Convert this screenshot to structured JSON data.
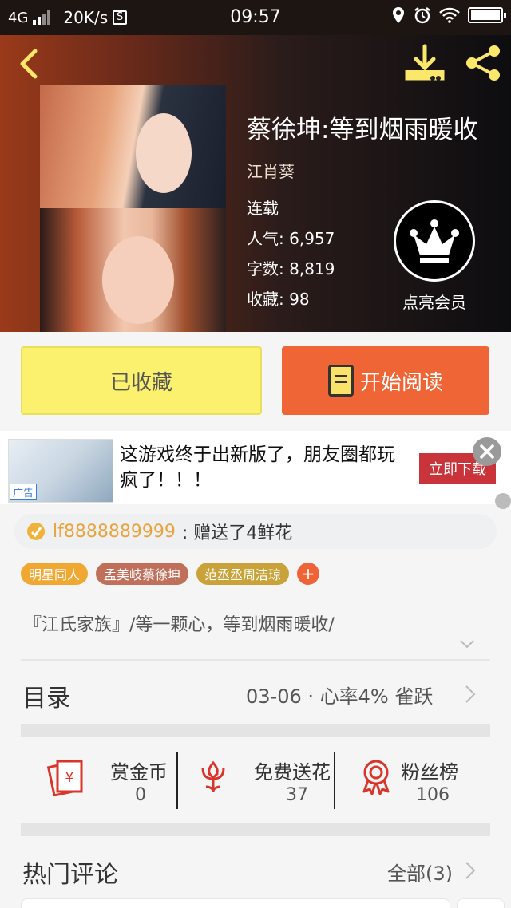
{
  "status_bar": {
    "network": "4G",
    "speed": "20K/s",
    "s_icon": "S",
    "time": "09:57",
    "icons": [
      "location-icon",
      "alarm-icon",
      "wifi-icon",
      "battery-icon"
    ],
    "battery_level": 1.0
  },
  "header": {
    "title": "蔡徐坤:等到烟雨暖收",
    "author": "江肖葵",
    "status": "连载",
    "popularity_label": "人气:",
    "popularity": "6,957",
    "words_label": "字数:",
    "words": "8,819",
    "favorites_label": "收藏:",
    "favorites": "98",
    "vip_label": "点亮会员"
  },
  "actions": {
    "favorited_label": "已收藏",
    "read_label": "开始阅读"
  },
  "ad": {
    "text": "这游戏终于出新版了，朋友圈都玩疯了！！！",
    "cta": "立即下载",
    "tag": "广告"
  },
  "flower": {
    "user": "lf8888889999",
    "message": ": 赠送了4鲜花"
  },
  "tags": [
    {
      "label": "明星同人",
      "color": "#f0a832"
    },
    {
      "label": "孟美岐蔡徐坤",
      "color": "#c0705a"
    },
    {
      "label": "范丞丞周洁琼",
      "color": "#c9a33a"
    }
  ],
  "tag_add": "+",
  "description": "『江氏家族』/等一颗心，等到烟雨暖收/",
  "toc": {
    "title": "目录",
    "info": "03-06 · 心率4% 雀跃"
  },
  "stats": [
    {
      "label": "赏金币",
      "value": "0",
      "icon": "red-envelope-icon"
    },
    {
      "label": "免费送花",
      "value": "37",
      "icon": "flower-icon"
    },
    {
      "label": "粉丝榜",
      "value": "106",
      "icon": "medal-icon"
    }
  ],
  "comments": {
    "title": "热门评论",
    "all": "全部(3)"
  },
  "colors": {
    "accent_orange": "#f06535",
    "fav_yellow": "#fbf16e",
    "icon_red": "#d9352b"
  }
}
